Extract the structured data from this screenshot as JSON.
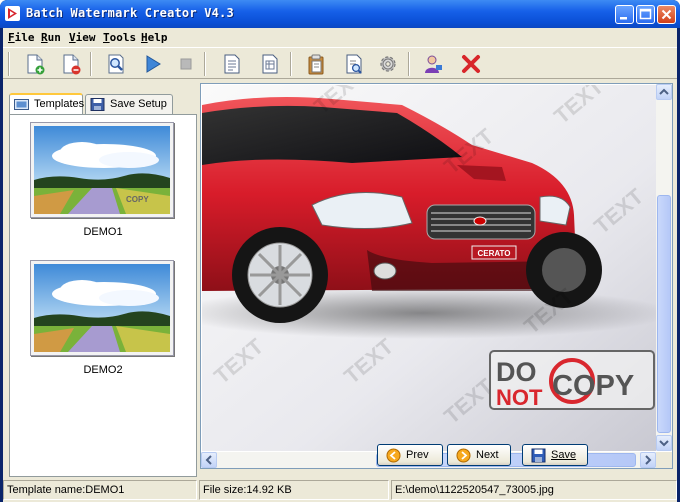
{
  "window": {
    "title": "Batch Watermark Creator V4.3"
  },
  "menu": {
    "items": [
      {
        "first": "F",
        "rest": "ile"
      },
      {
        "first": "R",
        "rest": "un"
      },
      {
        "first": "V",
        "rest": "iew"
      },
      {
        "first": "T",
        "rest": "ools"
      },
      {
        "first": "H",
        "rest": "elp"
      }
    ]
  },
  "toolbar": {
    "icons": [
      "add-file-icon",
      "remove-file-icon",
      "preview-icon",
      "run-icon",
      "stop-icon",
      "text-document-icon",
      "document-list-icon",
      "clipboard-icon",
      "edit-document-icon",
      "settings-icon",
      "user-icon",
      "delete-icon"
    ]
  },
  "left_panel": {
    "tabs": [
      {
        "label": "Templates",
        "active": true
      },
      {
        "label": "Save Setup",
        "active": false
      }
    ],
    "templates": [
      {
        "label": "DEMO1"
      },
      {
        "label": "DEMO2"
      }
    ]
  },
  "preview": {
    "badge": "CERATO",
    "watermark_pattern": "TEXT",
    "watermark_logo": {
      "line1": "DO",
      "line2": "NOT",
      "word2": "COPY"
    }
  },
  "buttons": {
    "prev": "Prev",
    "next": "Next",
    "save": "Save"
  },
  "status": {
    "template": "Template name:DEMO1",
    "filesize": "File size:14.92 KB",
    "path": "E:\\demo\\1122520547_73005.jpg"
  },
  "colors": {
    "title_bar": "#0a4fd6",
    "car_body": "#d81c2a",
    "watermark_red": "#d9272e",
    "window_face": "#ece9d8"
  }
}
